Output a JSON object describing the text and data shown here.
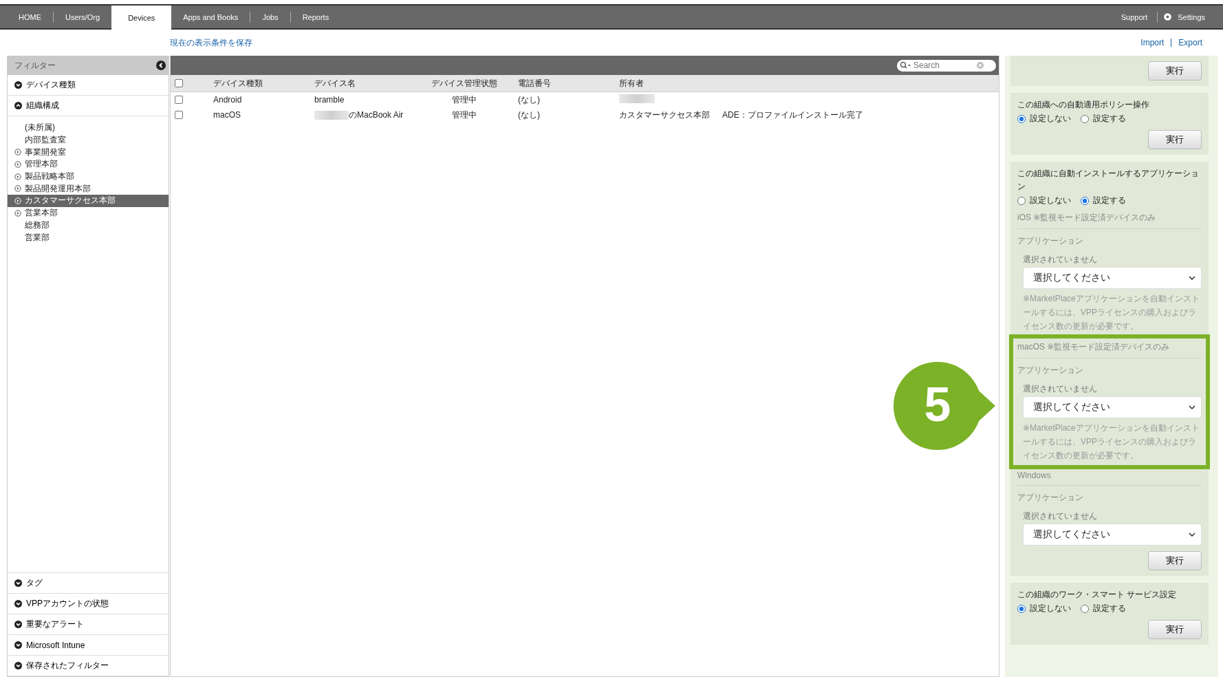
{
  "nav": {
    "tabs": [
      {
        "label": "HOME",
        "selected": false
      },
      {
        "label": "Users/Org",
        "selected": false
      },
      {
        "label": "Devices",
        "selected": true
      },
      {
        "label": "Apps and Books",
        "selected": false
      },
      {
        "label": "Jobs",
        "selected": false
      },
      {
        "label": "Reports",
        "selected": false
      }
    ],
    "right_links": [
      {
        "label": "Support",
        "kind": "plain"
      },
      {
        "label": "Settings",
        "kind": "gear"
      }
    ]
  },
  "save_link": "現在の表示条件を保存",
  "io_links": [
    "Import",
    "Export"
  ],
  "sidebar": {
    "title": "フィルター",
    "top_filters": [
      {
        "label": "デバイス種類",
        "expanded": false
      },
      {
        "label": "組織構成",
        "expanded": true
      }
    ],
    "org_tree": [
      {
        "label": "(未所属)",
        "expandable": false,
        "selected": false
      },
      {
        "label": "内部監査室",
        "expandable": false,
        "selected": false
      },
      {
        "label": "事業開発室",
        "expandable": true,
        "selected": false
      },
      {
        "label": "管理本部",
        "expandable": true,
        "selected": false
      },
      {
        "label": "製品戦略本部",
        "expandable": true,
        "selected": false
      },
      {
        "label": "製品開発運用本部",
        "expandable": true,
        "selected": false
      },
      {
        "label": "カスタマーサクセス本部",
        "expandable": true,
        "selected": true
      },
      {
        "label": "営業本部",
        "expandable": true,
        "selected": false
      },
      {
        "label": "総務部",
        "expandable": false,
        "selected": false
      },
      {
        "label": "営業部",
        "expandable": false,
        "selected": false
      }
    ],
    "bottom_filters": [
      {
        "label": "タグ",
        "expanded": false
      },
      {
        "label": "VPPアカウントの状態",
        "expanded": false
      },
      {
        "label": "重要なアラート",
        "expanded": false
      },
      {
        "label": "Microsoft Intune",
        "expanded": false
      },
      {
        "label": "保存されたフィルター",
        "expanded": false
      }
    ]
  },
  "search": {
    "placeholder": "Search"
  },
  "table": {
    "select_all_checked": false,
    "columns": [
      "デバイス種類",
      "デバイス名",
      "デバイス管理状態",
      "電話番号",
      "所有者"
    ],
    "rows": [
      {
        "checked": false,
        "device_type": "Android",
        "device_name": "bramble",
        "name_redacted": false,
        "status": "管理中",
        "phone": "(なし)",
        "owner_redacted": true
      },
      {
        "checked": false,
        "device_type": "macOS",
        "device_name": "のMacBook Air",
        "name_redacted": true,
        "status": "管理中",
        "phone": "(なし)",
        "owner": "カスタマーサクセス本部",
        "owner_redacted": false,
        "note": "ADE：プロファイルインストール完了"
      }
    ]
  },
  "panel": {
    "cards": [
      {
        "button": "実行"
      },
      {
        "title": "この組織への自動適用ポリシー操作",
        "options": [
          {
            "label": "設定しない",
            "selected": true
          },
          {
            "label": "設定する",
            "selected": false
          }
        ],
        "button": "実行"
      },
      {
        "title": "この組織に自動インストールするアプリケーション",
        "options": [
          {
            "label": "設定しない",
            "selected": false
          },
          {
            "label": "設定する",
            "selected": true
          }
        ],
        "sections": [
          {
            "platform": "iOS ※監視モード設定済デバイスのみ",
            "label": "アプリケーション",
            "status": "選択されていません",
            "select": "選択してください",
            "note": "※MarketPlaceアプリケーションを自動インストールするには、VPPライセンスの購入およびライセンス数の更新が必要です。",
            "highlighted": false
          },
          {
            "platform": "macOS ※監視モード設定済デバイスのみ",
            "label": "アプリケーション",
            "status": "選択されていません",
            "select": "選択してください",
            "note": "※MarketPlaceアプリケーションを自動インストールするには、VPPライセンスの購入およびライセンス数の更新が必要です。",
            "highlighted": true
          },
          {
            "platform": "Windows",
            "label": "アプリケーション",
            "status": "選択されていません",
            "select": "選択してください",
            "highlighted": false
          }
        ],
        "button": "実行"
      },
      {
        "title": "この組織のワーク・スマート サービス設定",
        "options": [
          {
            "label": "設定しない",
            "selected": true
          },
          {
            "label": "設定する",
            "selected": false
          }
        ],
        "button": "実行"
      }
    ]
  },
  "callout": {
    "number": "5"
  }
}
